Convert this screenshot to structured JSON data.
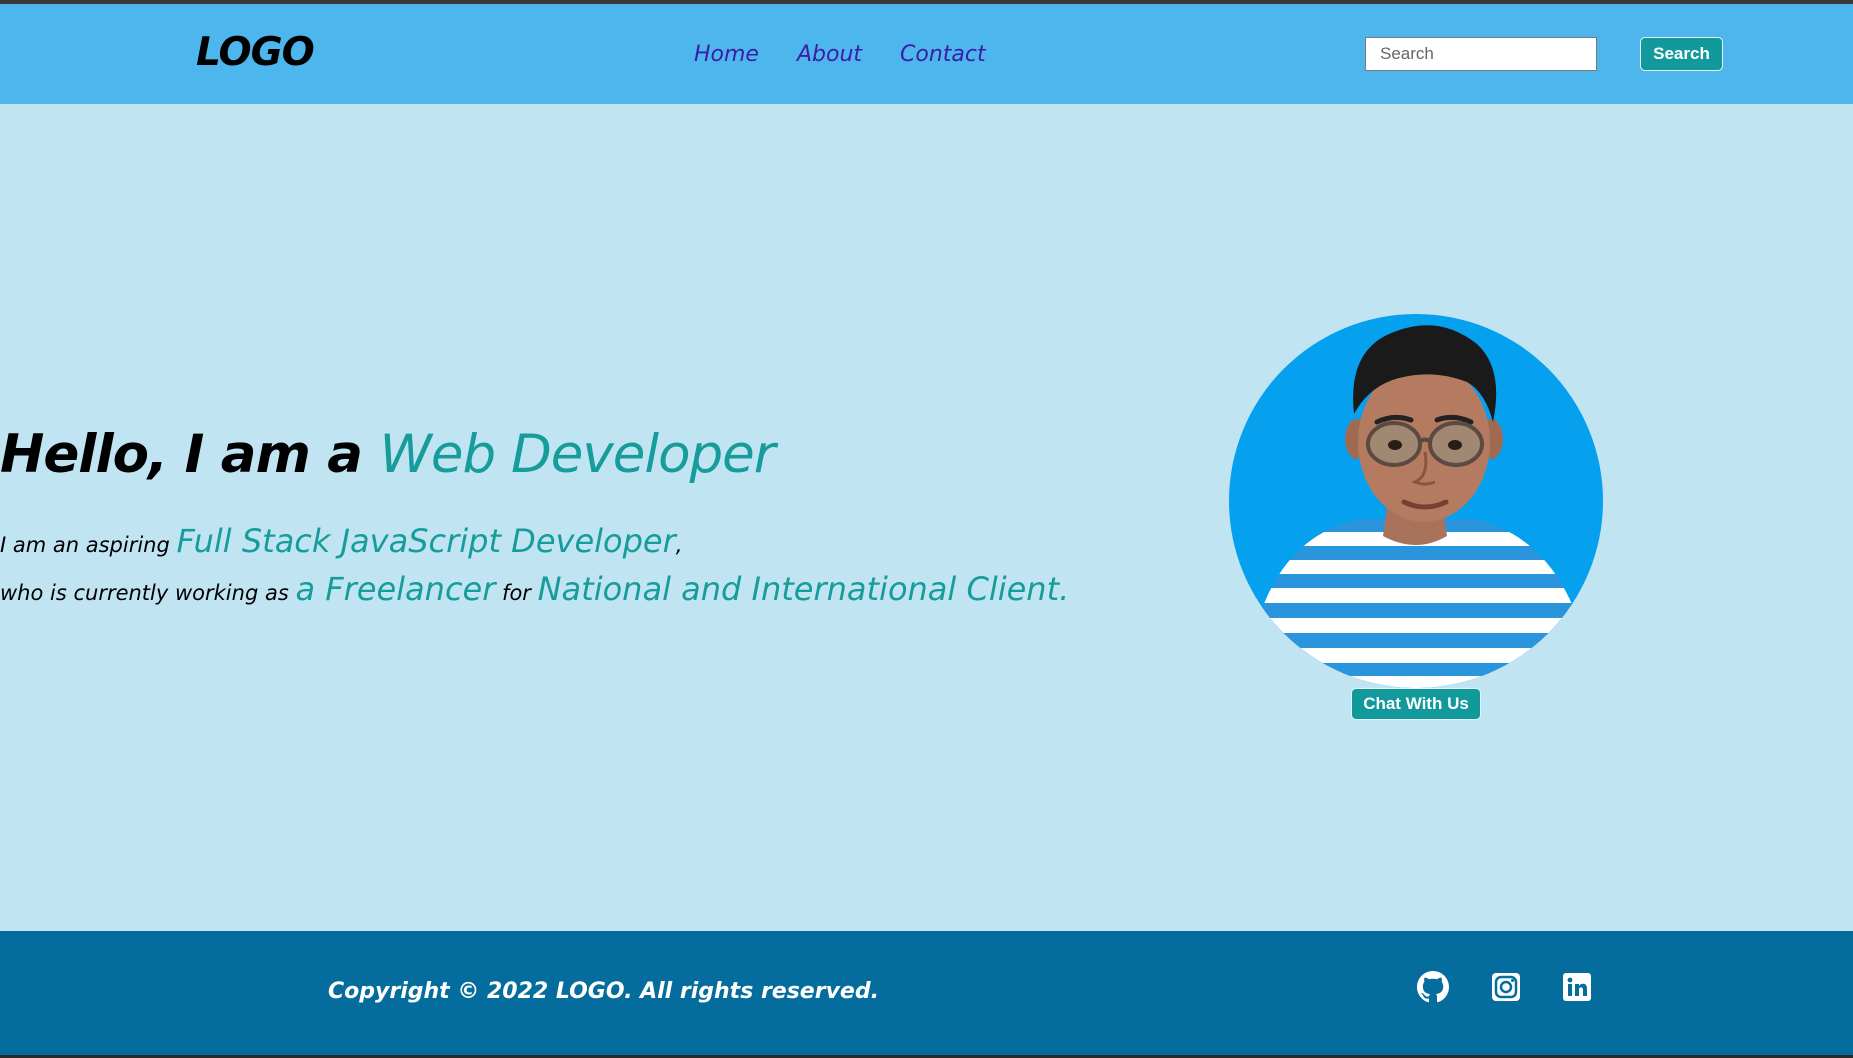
{
  "header": {
    "logo": "LOGO",
    "nav": [
      {
        "label": "Home"
      },
      {
        "label": "About"
      },
      {
        "label": "Contact"
      }
    ],
    "search": {
      "placeholder": "Search",
      "value": ""
    },
    "search_button_label": "Search"
  },
  "hero": {
    "headline_prefix": "Hello, I am a ",
    "headline_accent": "Web Developer",
    "line1": {
      "prefix": "I am an aspiring ",
      "highlight": "Full Stack JavaScript Developer",
      "suffix": ","
    },
    "line2": {
      "prefix": "who is currently working as ",
      "highlight1": "a Freelancer",
      "middle": " for ",
      "highlight2": "National and International Client."
    },
    "chat_button_label": "Chat With Us"
  },
  "footer": {
    "copyright": "Copyright © 2022 LOGO. All rights reserved.",
    "social": [
      {
        "icon": "github-icon"
      },
      {
        "icon": "instagram-icon"
      },
      {
        "icon": "linkedin-icon"
      }
    ]
  },
  "colors": {
    "header_bg": "#4db6ec",
    "hero_bg": "#c1e4f3",
    "accent": "#169c9a",
    "nav_link": "#3b1ea8",
    "footer_bg": "#046d9d"
  }
}
